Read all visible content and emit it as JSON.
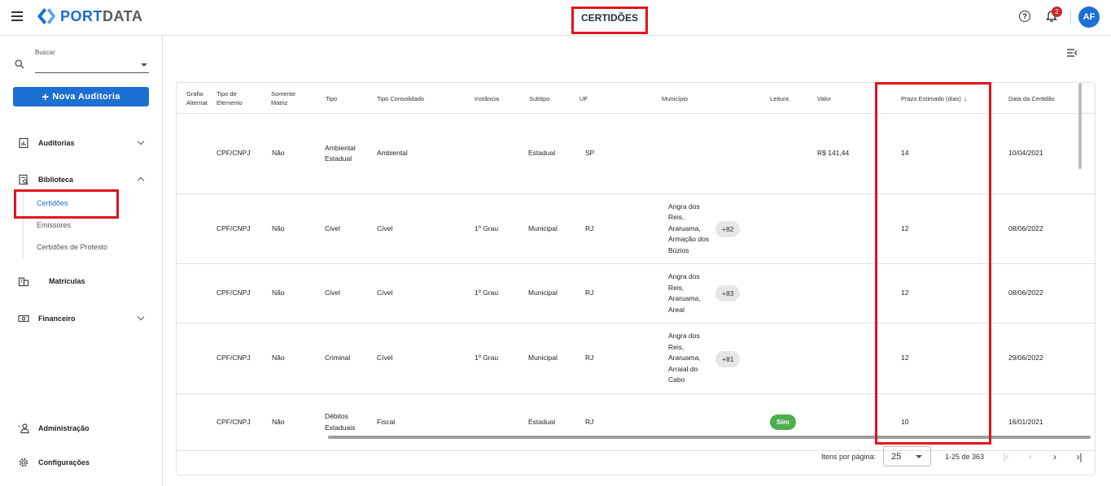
{
  "app": {
    "brand": "PORTDATA",
    "brand_prefix": "PORT",
    "brand_suffix": "DATA"
  },
  "header": {
    "title": "CERTIDÕES",
    "notification_count": "2",
    "avatar_initials": "AF"
  },
  "sidebar": {
    "search": {
      "label": "Buscar",
      "value": ""
    },
    "new_audit_label": "Nova Auditoria",
    "items": [
      {
        "label": "Auditorias",
        "icon": "report-icon",
        "expanded": false
      },
      {
        "label": "Biblioteca",
        "icon": "library-icon",
        "expanded": true
      },
      {
        "label": "Matrículas",
        "icon": "building-icon"
      },
      {
        "label": "Financeiro",
        "icon": "money-icon",
        "expanded": false
      },
      {
        "label": "Administração",
        "icon": "admin-icon"
      },
      {
        "label": "Configurações",
        "icon": "gear-icon"
      }
    ],
    "biblioteca_sub": [
      "Certidões",
      "Emissores",
      "Certidões de Protesto"
    ]
  },
  "table": {
    "columns": [
      "Grafia Alternativa",
      "Tipo de Elemento",
      "Somente Matriz",
      "Tipo",
      "Tipo Consolidado",
      "Instância",
      "Subtipo",
      "UF",
      "Município",
      "Leitura",
      "Valor",
      "Prazo Estimado (dias)",
      "Data da Certidão"
    ],
    "col_label_visible": [
      "Grafia Alternat",
      "Tipo de Elemento",
      "Somente Matriz",
      "Tipo",
      "Tipo Consolidado",
      "Instância",
      "Subtipo",
      "UF",
      "Município",
      "Leitura",
      "Valor",
      "Prazo Estimado (dias)",
      "Data da Certidão"
    ],
    "sorted_column": "Prazo Estimado (dias)",
    "sort_direction": "desc",
    "rows": [
      {
        "tipo_elemento": "CPF/CNPJ",
        "somente_matriz": "Não",
        "tipo": "Ambiental Estadual",
        "tipo_consolidado": "Ambiental",
        "instancia": "",
        "subtipo": "Estadual",
        "uf": "SP",
        "municipio": "",
        "municipio_more": "",
        "leitura": "",
        "valor": "R$ 141,44",
        "prazo": "14",
        "data": "10/04/2021"
      },
      {
        "tipo_elemento": "CPF/CNPJ",
        "somente_matriz": "Não",
        "tipo": "Civel",
        "tipo_consolidado": "Cível",
        "instancia": "1º Grau",
        "subtipo": "Municipal",
        "uf": "RJ",
        "municipio": "Angra dos Reis, Araruama, Armação dos Búzios",
        "municipio_more": "+82",
        "leitura": "",
        "valor": "",
        "prazo": "12",
        "data": "08/06/2022"
      },
      {
        "tipo_elemento": "CPF/CNPJ",
        "somente_matriz": "Não",
        "tipo": "Civel",
        "tipo_consolidado": "Cível",
        "instancia": "1º Grau",
        "subtipo": "Municipal",
        "uf": "RJ",
        "municipio": "Angra dos Reis, Araruama, Areal",
        "municipio_more": "+83",
        "leitura": "",
        "valor": "",
        "prazo": "12",
        "data": "08/06/2022"
      },
      {
        "tipo_elemento": "CPF/CNPJ",
        "somente_matriz": "Não",
        "tipo": "Criminal",
        "tipo_consolidado": "Cível",
        "instancia": "1º Grau",
        "subtipo": "Municipal",
        "uf": "RJ",
        "municipio": "Angra dos Reis, Araruama, Arraial do Cabo",
        "municipio_more": "+81",
        "leitura": "",
        "valor": "",
        "prazo": "12",
        "data": "29/06/2022"
      },
      {
        "tipo_elemento": "CPF/CNPJ",
        "somente_matriz": "Não",
        "tipo": "Débitos Estaduais",
        "tipo_consolidado": "Fiscal",
        "instancia": "",
        "subtipo": "Estadual",
        "uf": "RJ",
        "municipio": "",
        "municipio_more": "",
        "leitura": "Sim",
        "valor": "",
        "prazo": "10",
        "data": "16/01/2021"
      }
    ]
  },
  "paginator": {
    "items_per_page_label": "Itens por página:",
    "page_size": "25",
    "range_label": "1-25 de 363"
  },
  "colors": {
    "brand_blue": "#1c6fd3",
    "highlight_red": "#e0141f",
    "chip_green": "#4caf50",
    "badge_red": "#c62828"
  }
}
